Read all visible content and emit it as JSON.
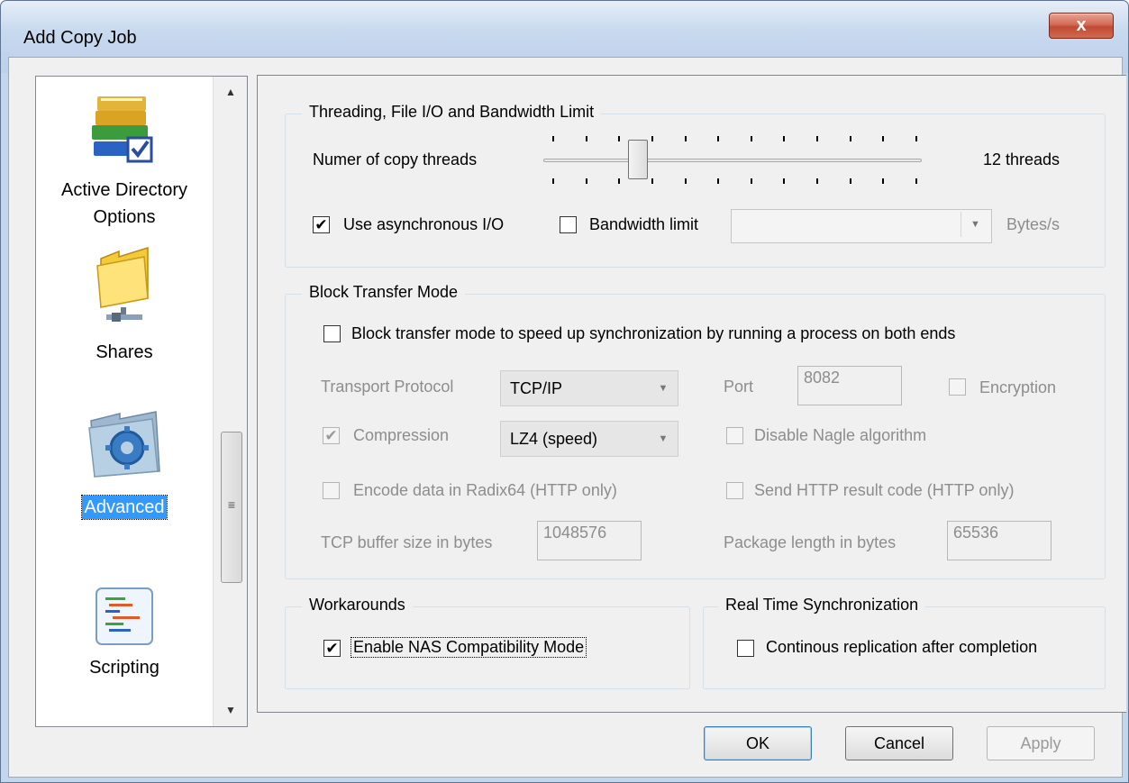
{
  "window": {
    "title": "Add Copy Job",
    "close_glyph": "x"
  },
  "sidebar": {
    "items": [
      {
        "label_line1": "Active Directory",
        "label_line2": "Options",
        "icon": "books-checkbox-icon"
      },
      {
        "label": "Shares",
        "icon": "shared-folder-icon"
      },
      {
        "label": "Advanced",
        "icon": "gear-folder-icon",
        "selected": true
      },
      {
        "label": "Scripting",
        "icon": "script-icon"
      }
    ],
    "scroll_up": "▲",
    "scroll_down": "▼",
    "scroll_grip": "≡"
  },
  "threading": {
    "title": "Threading, File I/O and Bandwidth Limit",
    "threads_label": "Numer of copy threads",
    "threads_value": "12 threads",
    "slider_fraction": 0.23,
    "async_label": "Use asynchronous I/O",
    "async_checked": true,
    "bandwidth_label": "Bandwidth limit",
    "bandwidth_checked": false,
    "bandwidth_value": "",
    "bandwidth_unit": "Bytes/s"
  },
  "block": {
    "title": "Block Transfer Mode",
    "enable_label": "Block transfer mode to speed up synchronization by running a process on both ends",
    "enable_checked": false,
    "transport_label": "Transport Protocol",
    "transport_value": "TCP/IP",
    "port_label": "Port",
    "port_value": "8082",
    "encryption_label": "Encryption",
    "compression_label": "Compression",
    "compression_checked": true,
    "compression_value": "LZ4 (speed)",
    "nagle_label": "Disable Nagle algorithm",
    "radix_label": "Encode data in Radix64 (HTTP only)",
    "http_result_label": "Send HTTP result code (HTTP only)",
    "tcp_buffer_label": "TCP buffer size in bytes",
    "tcp_buffer_value": "1048576",
    "package_label": "Package length in bytes",
    "package_value": "65536"
  },
  "workarounds": {
    "title": "Workarounds",
    "nas_label": "Enable NAS Compatibility Mode",
    "nas_checked": true
  },
  "realtime": {
    "title": "Real Time Synchronization",
    "continuous_label": "Continous replication after completion",
    "continuous_checked": false
  },
  "buttons": {
    "ok": "OK",
    "cancel": "Cancel",
    "apply": "Apply"
  },
  "check_mark": "✔"
}
